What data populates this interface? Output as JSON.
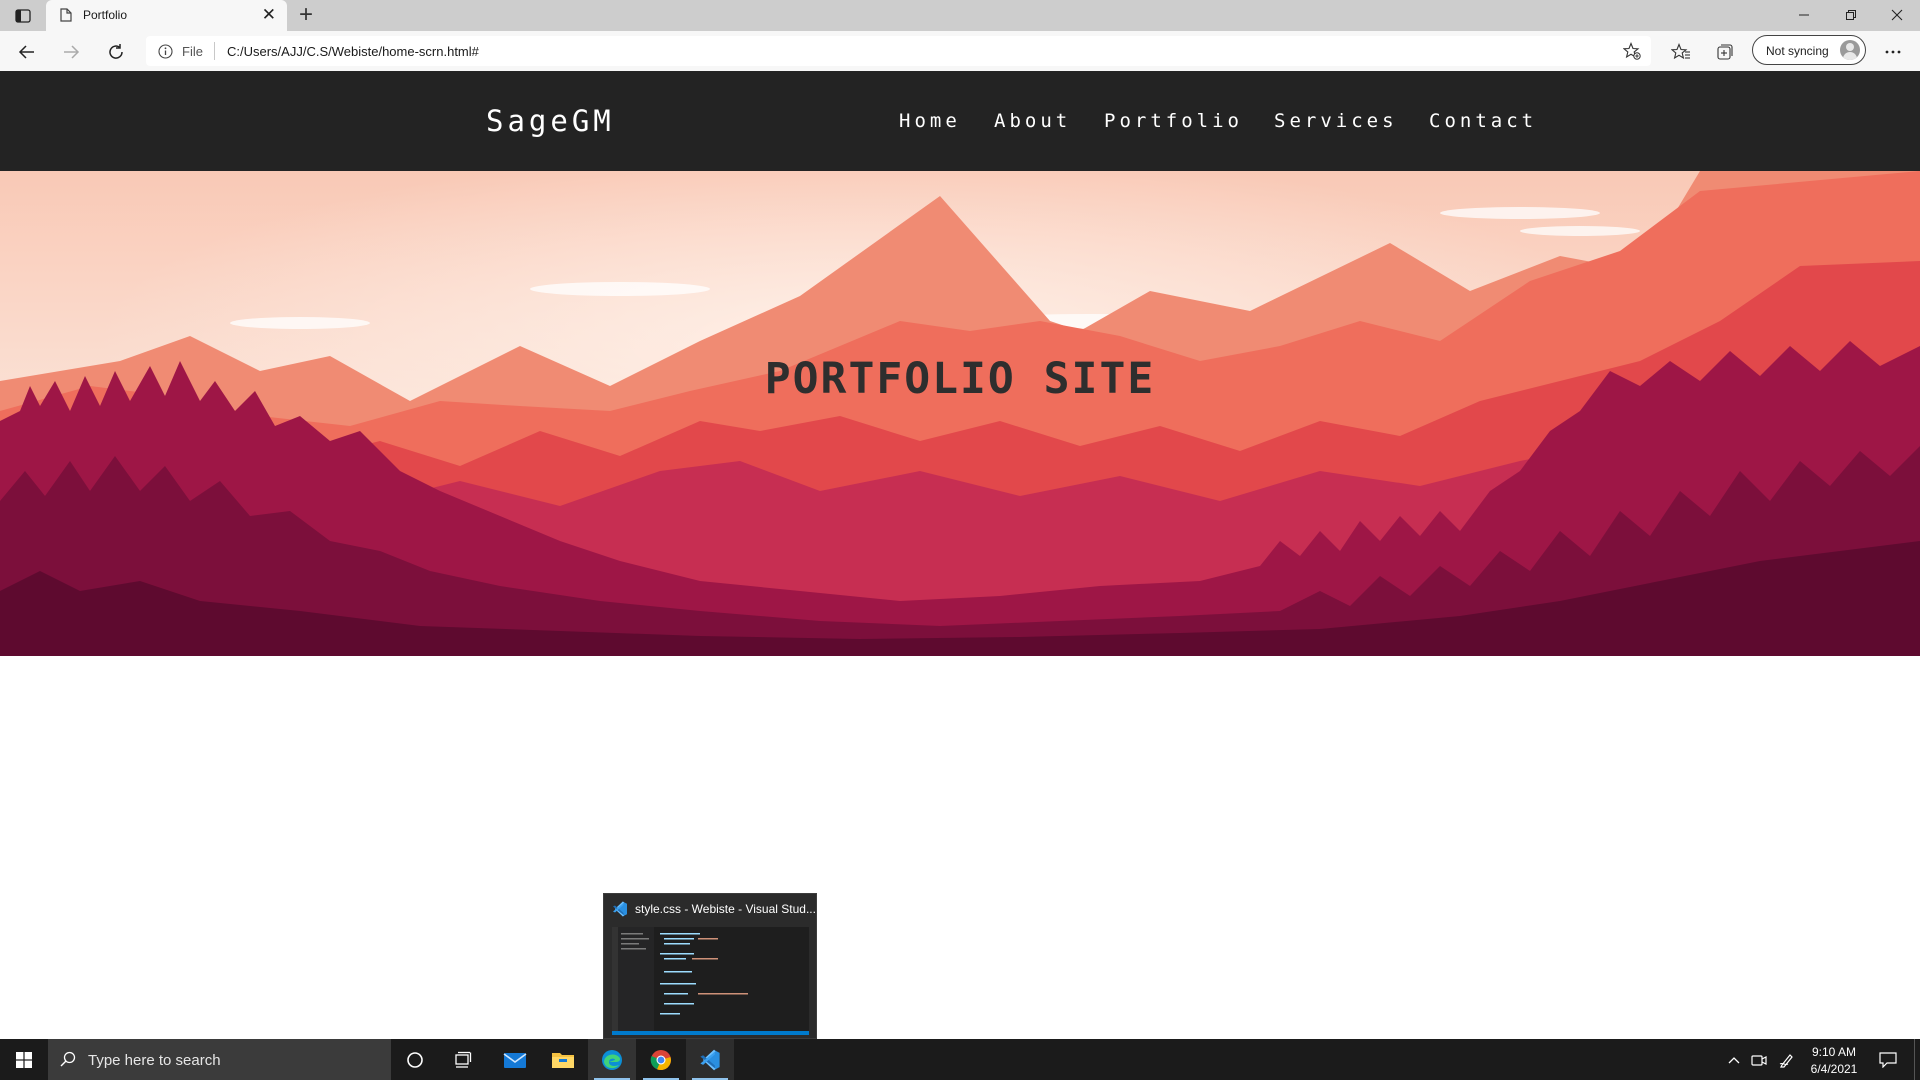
{
  "browser": {
    "tab_title": "Portfolio",
    "tab_close": "✕",
    "new_tab": "+",
    "address_scheme": "File",
    "address_url": "C:/Users/AJJ/C.S/Webiste/home-scrn.html#",
    "sync_label": "Not syncing"
  },
  "site": {
    "brand": "SageGM",
    "nav": [
      "Home",
      "About",
      "Portfolio",
      "Services",
      "Contact"
    ],
    "hero_title": "PORTFOLIO SITE",
    "colors": {
      "nav_bg": "#232323",
      "hero_sky": "#f7c4b0",
      "hero_mountain": "#e95b4a",
      "hero_forest": "#7d0f3c"
    }
  },
  "taskbar": {
    "search_placeholder": "Type here to search",
    "preview_title": "style.css - Webiste - Visual Stud...",
    "time": "9:10 AM",
    "date": "6/4/2021",
    "apps": [
      "cortana-icon",
      "task-view-icon",
      "mail-icon",
      "file-explorer-icon",
      "edge-icon",
      "chrome-icon",
      "vscode-icon"
    ]
  }
}
